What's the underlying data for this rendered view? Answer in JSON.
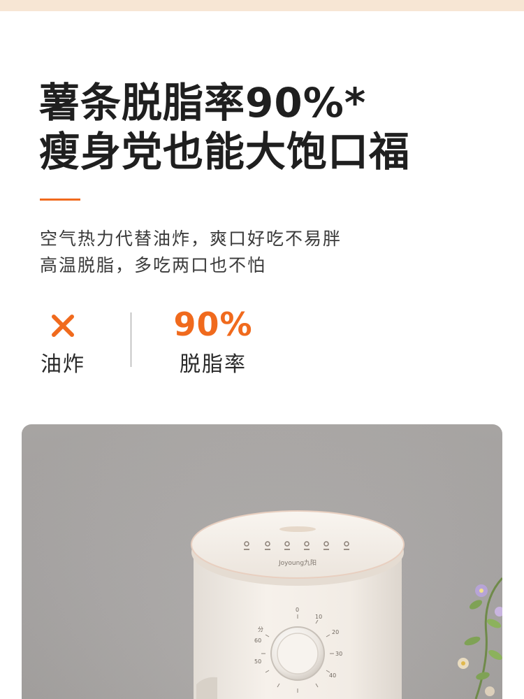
{
  "headline": {
    "line1": "薯条脱脂率90%*",
    "line2": "瘦身党也能大饱口福"
  },
  "description": {
    "line1": "空气热力代替油炸，爽口好吃不易胖",
    "line2": "高温脱脂，多吃两口也不怕"
  },
  "stats": {
    "oil_fry": {
      "icon": "cross-icon",
      "label": "油炸"
    },
    "fat_removal": {
      "value": "90%",
      "label": "脱脂率"
    }
  },
  "product_photo": {
    "brand_text": "Joyoung九阳",
    "timer_dial": {
      "unit_label": "分",
      "ticks": [
        "0",
        "10",
        "20",
        "30",
        "40",
        "50",
        "60"
      ]
    }
  },
  "colors": {
    "accent": "#f06a1d",
    "top_band": "#f7e6d4",
    "headline_text": "#1f1f1f"
  }
}
